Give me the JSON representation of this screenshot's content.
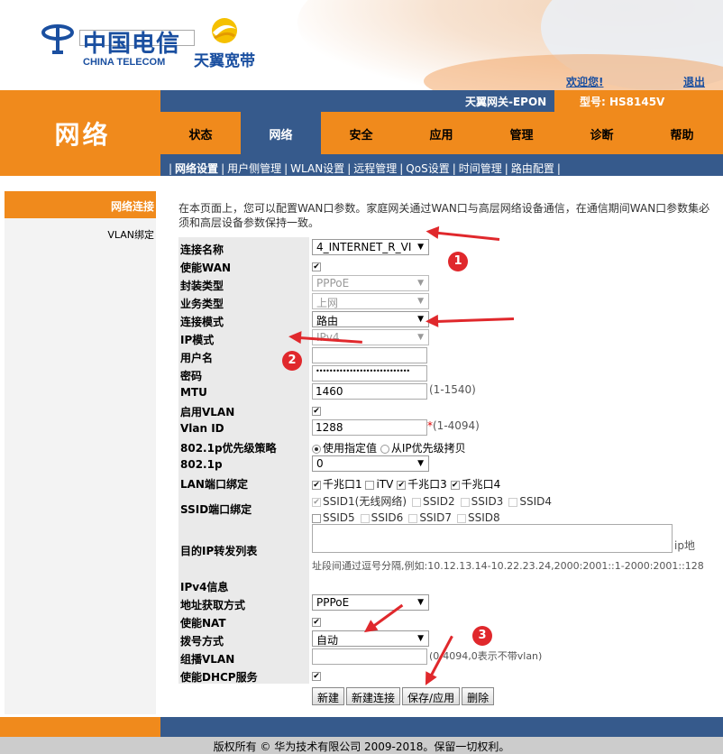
{
  "header": {
    "brand_cn": "中国电信",
    "brand_en": "CHINA TELECOM",
    "sub_brand": "天翼宽带",
    "welcome": "欢迎您!",
    "logout": "退出"
  },
  "titlebar": {
    "gateway": "天翼网关-EPON",
    "model": "型号: HS8145V"
  },
  "section_title": "网络",
  "tabs": [
    {
      "label": "状态"
    },
    {
      "label": "网络"
    },
    {
      "label": "安全"
    },
    {
      "label": "应用"
    },
    {
      "label": "管理"
    },
    {
      "label": "诊断"
    },
    {
      "label": "帮助"
    }
  ],
  "subnav": [
    {
      "label": "网络设置"
    },
    {
      "label": "用户侧管理"
    },
    {
      "label": "WLAN设置"
    },
    {
      "label": "远程管理"
    },
    {
      "label": "QoS设置"
    },
    {
      "label": "时间管理"
    },
    {
      "label": "路由配置"
    }
  ],
  "sidebar": {
    "active": "网络连接",
    "items": [
      {
        "label": "VLAN绑定"
      }
    ]
  },
  "description": "在本页面上，您可以配置WAN口参数。家庭网关通过WAN口与高层网络设备通信，在通信期间WAN口参数集必须和高层设备参数保持一致。",
  "form": {
    "conn_name": {
      "label": "连接名称",
      "value": "4_INTERNET_R_VI"
    },
    "enable_wan": {
      "label": "使能WAN"
    },
    "encap": {
      "label": "封装类型",
      "value": "PPPoE"
    },
    "service": {
      "label": "业务类型",
      "value": "上网"
    },
    "conn_mode": {
      "label": "连接模式",
      "value": "路由"
    },
    "ip_mode": {
      "label": "IP模式",
      "value": "IPv4"
    },
    "username": {
      "label": "用户名",
      "value": ""
    },
    "password": {
      "label": "密码",
      "value": "••••••••••••••••••••••••••••"
    },
    "mtu": {
      "label": "MTU",
      "value": "1460",
      "hint": "(1-1540)"
    },
    "enable_vlan": {
      "label": "启用VLAN"
    },
    "vlan_id": {
      "label": "Vlan ID",
      "value": "1288",
      "hint": "(1-4094)",
      "star": "*"
    },
    "priority_policy": {
      "label": "802.1p优先级策略",
      "opt1": "使用指定值",
      "opt2": "从IP优先级拷贝"
    },
    "p8021": {
      "label": "802.1p",
      "value": "0"
    },
    "lan_bind": {
      "label": "LAN端口绑定",
      "ports": [
        "千兆口1",
        "iTV",
        "千兆口3",
        "千兆口4"
      ]
    },
    "ssid_bind": {
      "label": "SSID端口绑定",
      "ssids": [
        "SSID1(无线网络)",
        "SSID2",
        "SSID3",
        "SSID4",
        "SSID5",
        "SSID6",
        "SSID7",
        "SSID8"
      ]
    },
    "dest_ip": {
      "label": "目的IP转发列表",
      "suffix": "ip地",
      "hint": "址段间通过逗号分隔,例如:10.12.13.14-10.22.23.24,2000:2001::1-2000:2001::128"
    },
    "ipv4_info": {
      "label": "IPv4信息"
    },
    "addr_mode": {
      "label": "地址获取方式",
      "value": "PPPoE"
    },
    "enable_nat": {
      "label": "使能NAT"
    },
    "dial_mode": {
      "label": "拨号方式",
      "value": "自动"
    },
    "mcast_vlan": {
      "label": "组播VLAN",
      "value": "",
      "hint": "(0-4094,0表示不带vlan)"
    },
    "enable_dhcp": {
      "label": "使能DHCP服务"
    }
  },
  "buttons": {
    "new": "新建",
    "new_conn": "新建连接",
    "save": "保存/应用",
    "delete": "删除"
  },
  "annotations": [
    "1",
    "2",
    "3"
  ],
  "footer": "版权所有 © 华为技术有限公司 2009-2018。保留一切权利。",
  "colors": {
    "orange": "#f08a1c",
    "blue": "#365a8c",
    "red": "#e0282c"
  }
}
